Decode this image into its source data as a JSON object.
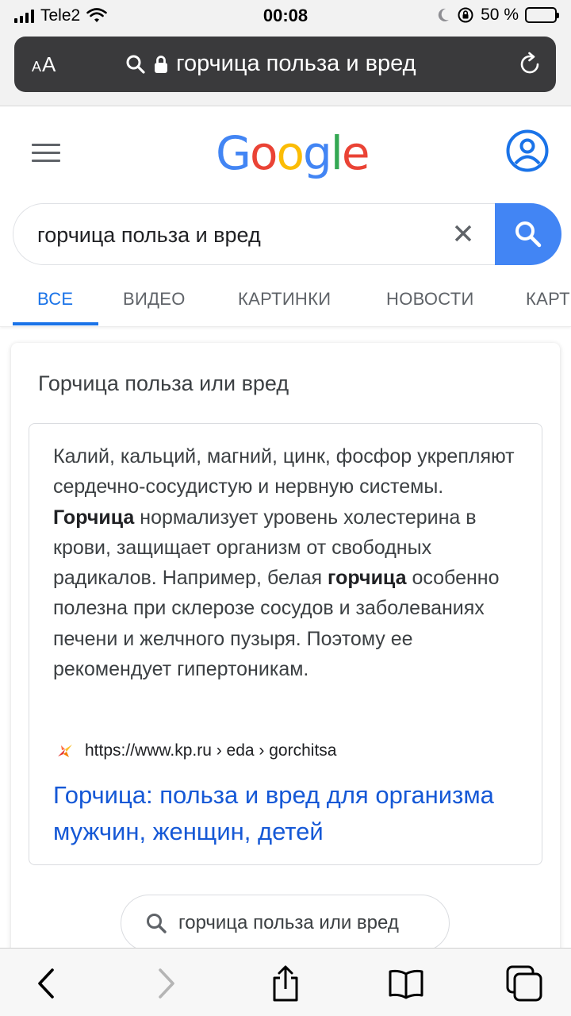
{
  "status_bar": {
    "carrier": "Tele2",
    "time": "00:08",
    "battery": "50 %",
    "battery_level": 0.5
  },
  "browser": {
    "text_size_label": "AA",
    "url_text": "горчица польза и вред"
  },
  "google": {
    "logo": "Google",
    "search_query": "горчица польза и вред",
    "tabs": [
      "ВСЕ",
      "ВИДЕО",
      "КАРТИНКИ",
      "НОВОСТИ",
      "КАРТЫ"
    ],
    "active_tab": "ВСЕ"
  },
  "result": {
    "question": "Горчица польза или вред",
    "snippet_parts": {
      "p1": "Калий, кальций, магний, цинк, фосфор укрепляют сердечно-сосудистую и нервную системы. ",
      "b1": "Горчица",
      "p2": " нормализует уровень холестерина в крови, защищает организм от свободных радикалов. Например, белая ",
      "b2": "горчица",
      "p3": " особенно полезна при склерозе сосудов и заболеваниях печени и желчного пузыря. Поэтому ее рекомендует гипертоникам."
    },
    "source_url": "https://www.kp.ru › eda › gorchitsa",
    "link_title": "Горчица: польза и вред для организма мужчин, женщин, детей",
    "related_search": "горчица польза или вред"
  },
  "colors": {
    "google_blue": "#4285f4",
    "active_tab": "#1a73e8",
    "link": "#1558d6",
    "address_bar": "#3a3a3c"
  },
  "icons": [
    "wifi-icon",
    "moon-icon",
    "orientation-lock-icon",
    "battery-icon",
    "search-icon",
    "lock-icon",
    "reload-icon",
    "hamburger-menu-icon",
    "account-icon",
    "clear-icon",
    "kp-favicon",
    "back-icon",
    "forward-icon",
    "share-icon",
    "bookmarks-icon",
    "tabs-icon"
  ]
}
